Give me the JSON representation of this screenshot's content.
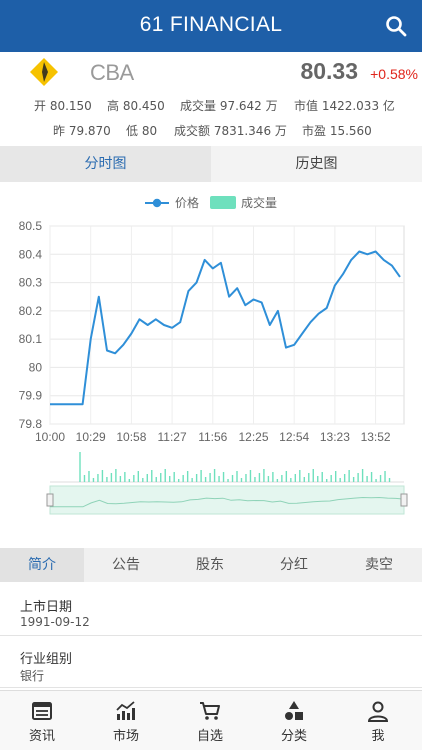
{
  "header": {
    "title": "61 FINANCIAL"
  },
  "stock": {
    "ticker": "CBA",
    "price": "80.33",
    "change": "+0.58%",
    "row1": [
      "开 80.150",
      "高 80.450",
      "成交量 97.642 万",
      "市值 1422.033 亿"
    ],
    "row2": [
      "昨 79.870",
      "低 80",
      "成交额 7831.346 万",
      "市盈 15.560"
    ]
  },
  "tabs": [
    "分时图",
    "历史图"
  ],
  "legend": {
    "price": "价格",
    "volume": "成交量"
  },
  "colors": {
    "header": "#1e5fa8",
    "line": "#2f8fd8",
    "volume": "#6ee0bd",
    "up": "#e0251b"
  },
  "chart_data": {
    "type": "line",
    "series": [
      {
        "name": "价格",
        "x": [
          "10:00",
          "10:06",
          "10:12",
          "10:18",
          "10:24",
          "10:29",
          "10:35",
          "10:41",
          "10:47",
          "10:53",
          "10:58",
          "11:04",
          "11:10",
          "11:16",
          "11:21",
          "11:27",
          "11:33",
          "11:39",
          "11:45",
          "11:50",
          "11:56",
          "12:02",
          "12:08",
          "12:14",
          "12:19",
          "12:25",
          "12:31",
          "12:37",
          "12:43",
          "12:48",
          "12:54",
          "13:00",
          "13:06",
          "13:12",
          "13:17",
          "13:23",
          "13:29",
          "13:35",
          "13:41",
          "13:46",
          "13:52",
          "13:58",
          "14:04",
          "14:07"
        ],
        "values": [
          79.87,
          79.87,
          79.87,
          79.87,
          79.87,
          80.1,
          80.25,
          80.06,
          80.05,
          80.08,
          80.12,
          80.17,
          80.15,
          80.17,
          80.15,
          80.14,
          80.16,
          80.27,
          80.3,
          80.38,
          80.35,
          80.37,
          80.25,
          80.28,
          80.22,
          80.24,
          80.23,
          80.15,
          80.2,
          80.07,
          80.08,
          80.12,
          80.16,
          80.19,
          80.21,
          80.29,
          80.33,
          80.38,
          80.41,
          80.4,
          80.41,
          80.38,
          80.36,
          80.32
        ]
      }
    ],
    "x_ticks": [
      "10:00",
      "10:29",
      "10:58",
      "11:27",
      "11:56",
      "12:25",
      "12:54",
      "13:23",
      "13:52"
    ],
    "y_ticks": [
      79.8,
      79.9,
      80,
      80.1,
      80.2,
      80.3,
      80.4,
      80.5
    ],
    "ylim": [
      79.8,
      80.5
    ],
    "grid": true,
    "legend_position": "top-center"
  },
  "subtabs": [
    "简介",
    "公告",
    "股东",
    "分红",
    "卖空"
  ],
  "profile": [
    {
      "label": "上市日期",
      "value": "1991-09-12"
    },
    {
      "label": "行业组别",
      "value": "银行"
    }
  ],
  "nav": [
    {
      "label": "资讯",
      "icon": "news-icon"
    },
    {
      "label": "市场",
      "icon": "market-icon"
    },
    {
      "label": "自选",
      "icon": "cart-icon"
    },
    {
      "label": "分类",
      "icon": "category-icon"
    },
    {
      "label": "我",
      "icon": "person-icon"
    }
  ]
}
